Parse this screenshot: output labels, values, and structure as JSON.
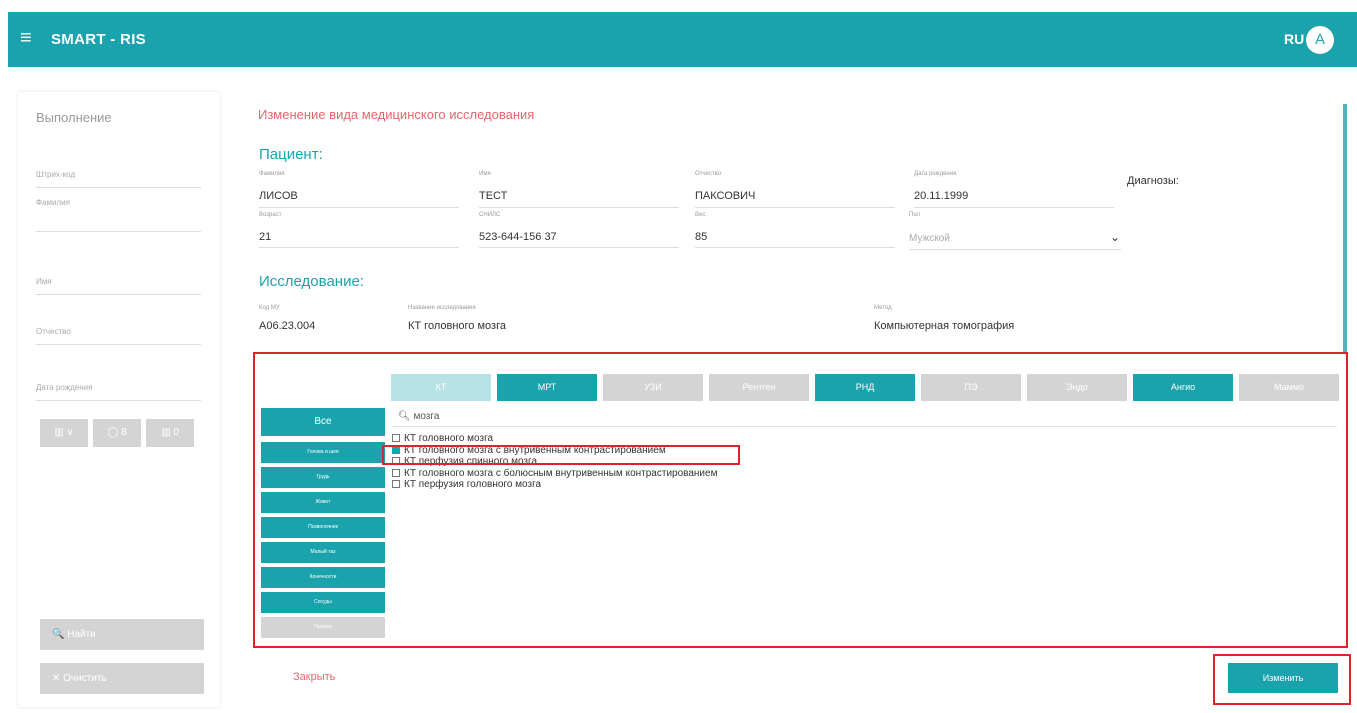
{
  "header": {
    "menu_icon": "≡",
    "app_title": "SMART - RIS",
    "lang": "RU",
    "avatar_letter": "A",
    "more_icon": "⋮"
  },
  "sidebar": {
    "heading": "Выполнение",
    "fields": [
      "Штрих-код",
      "Фамилия",
      "Имя",
      "Отчество",
      "Дата рождения"
    ],
    "tool_buttons": [
      "▥ ∨",
      "◯ 8",
      "▥ 0"
    ],
    "find_button": "🔍 Найти",
    "clear_button": "✕ Очистить"
  },
  "main": {
    "page_title": "Изменение вида медицинского исследования",
    "patient_heading": "Пациент:",
    "patient": {
      "lastname_label": "Фамилия",
      "lastname": "ЛИСОВ",
      "firstname_label": "Имя",
      "firstname": "ТЕСТ",
      "middlename_label": "Отчество",
      "middlename": "ПАКСОВИЧ",
      "birthdate_label": "Дата рождения",
      "birthdate": "20.11.1999",
      "diagnoses_label": "Диагнозы:",
      "age_label": "Возраст",
      "age": "21",
      "snils_label": "СНИЛС",
      "snils": "523-644-156 37",
      "weight_label": "Вес",
      "weight": "85",
      "sex_label": "Пол",
      "sex": "Мужской"
    },
    "study_heading": "Исследование:",
    "study": {
      "code_label": "Код МУ",
      "code": "A06.23.004",
      "name_label": "Название исследования",
      "name": "КТ головного мозга",
      "method_label": "Метод",
      "method": "Компьютерная томография"
    }
  },
  "modality_tabs": [
    "КТ",
    "МРТ",
    "УЗИ",
    "Рентген",
    "РНД",
    "ПЭ",
    "Эндо",
    "Ангио",
    "Маммо"
  ],
  "categories": [
    "Все",
    "Голова и шея",
    "Грудь",
    "Живот",
    "Позвоночник",
    "Малый таз",
    "Конечности",
    "Сосуды",
    "Прочее"
  ],
  "search_value": "мозга",
  "search_icon": "search-icon",
  "results": [
    {
      "label": "КТ головного мозга",
      "checked": false
    },
    {
      "label": "КТ головного мозга с внутривенным контрастированием",
      "checked": true
    },
    {
      "label": "КТ перфузия спинного мозга",
      "checked": false
    },
    {
      "label": "КТ головного мозга с болюсным внутривенным контрастированием",
      "checked": false
    },
    {
      "label": "КТ перфузия головного мозга",
      "checked": false
    }
  ],
  "footer": {
    "close": "Закрыть",
    "apply": "Изменить"
  },
  "colors": {
    "accent": "#1ba3ad",
    "danger": "#d9262c",
    "title": "#e5666a"
  }
}
